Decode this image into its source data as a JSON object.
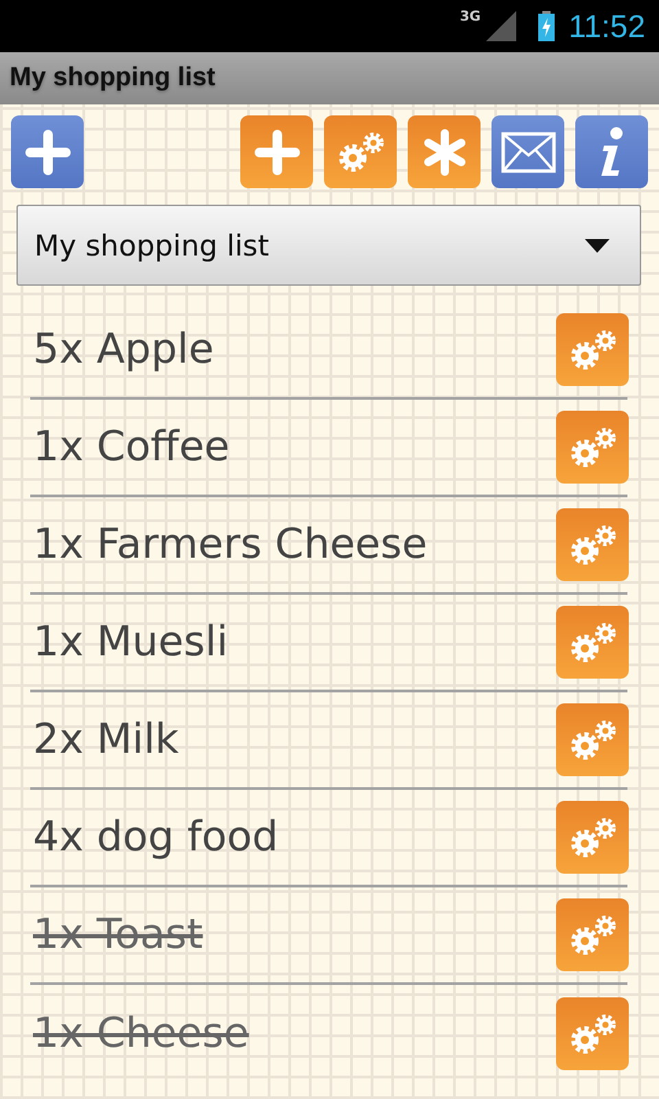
{
  "status_bar": {
    "network": "3G",
    "time": "11:52"
  },
  "title": "My shopping list",
  "list_selector": {
    "value": "My shopping list"
  },
  "items": [
    {
      "text": "5x Apple",
      "done": false
    },
    {
      "text": "1x Coffee",
      "done": false
    },
    {
      "text": "1x Farmers Cheese",
      "done": false
    },
    {
      "text": "1x Muesli",
      "done": false
    },
    {
      "text": "2x Milk",
      "done": false
    },
    {
      "text": "4x dog food",
      "done": false
    },
    {
      "text": "1x Toast",
      "done": true
    },
    {
      "text": "1x Cheese",
      "done": true
    }
  ]
}
